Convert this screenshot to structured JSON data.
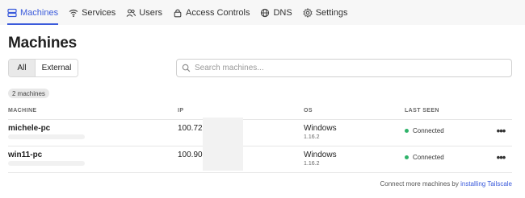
{
  "nav": {
    "items": [
      {
        "label": "Machines",
        "icon": "machines-icon",
        "active": true
      },
      {
        "label": "Services",
        "icon": "wifi-icon"
      },
      {
        "label": "Users",
        "icon": "users-icon"
      },
      {
        "label": "Access Controls",
        "icon": "lock-icon"
      },
      {
        "label": "DNS",
        "icon": "globe-icon"
      },
      {
        "label": "Settings",
        "icon": "gear-icon"
      }
    ]
  },
  "page": {
    "title": "Machines"
  },
  "filter": {
    "all_label": "All",
    "external_label": "External",
    "selected": "All"
  },
  "search": {
    "placeholder": "Search machines..."
  },
  "count_label": "2 machines",
  "table": {
    "headers": {
      "machine": "MACHINE",
      "ip": "IP",
      "os": "OS",
      "last_seen": "LAST SEEN"
    },
    "rows": [
      {
        "name": "michele-pc",
        "ip": "100.72.",
        "os": "Windows",
        "os_version": "1.16.2",
        "status": "Connected"
      },
      {
        "name": "win11-pc",
        "ip": "100.90.",
        "os": "Windows",
        "os_version": "1.16.2",
        "status": "Connected"
      }
    ],
    "menu_label": "•••"
  },
  "footer": {
    "text": "Connect more machines by ",
    "link": "installing Tailscale"
  },
  "colors": {
    "accent": "#3b5bdb",
    "connected": "#2fb36a"
  }
}
